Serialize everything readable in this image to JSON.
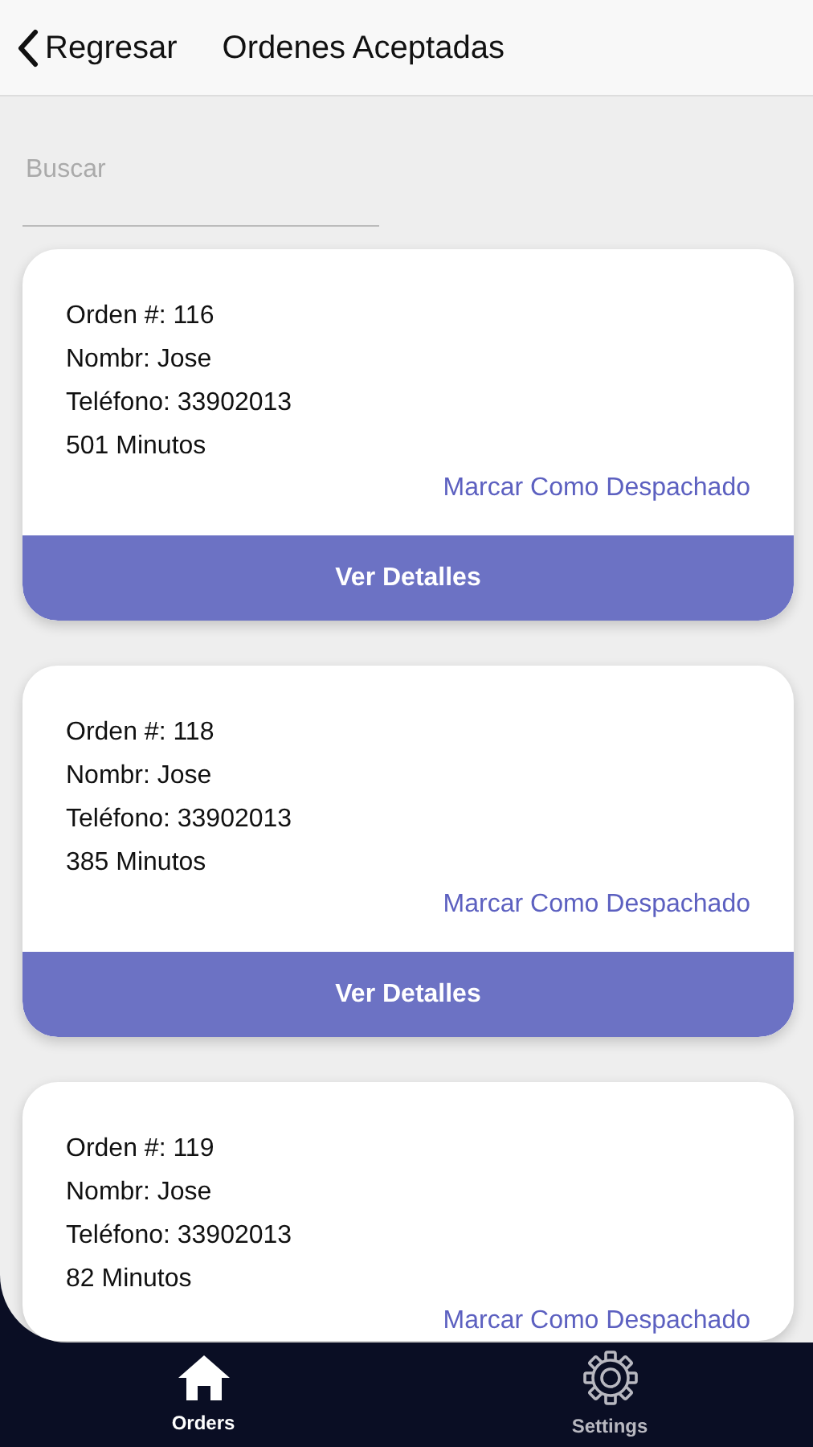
{
  "header": {
    "back": "Regresar",
    "title": "Ordenes Aceptadas"
  },
  "search": {
    "placeholder": "Buscar"
  },
  "orders": [
    {
      "order": "Orden #: 116",
      "name": "Nombr: Jose",
      "phone": "Teléfono: 33902013",
      "minutes": "501 Minutos",
      "action": "Marcar Como Despachado",
      "button": "Ver Detalles"
    },
    {
      "order": "Orden #: 118",
      "name": "Nombr: Jose",
      "phone": "Teléfono: 33902013",
      "minutes": "385 Minutos",
      "action": "Marcar Como Despachado",
      "button": "Ver Detalles"
    },
    {
      "order": "Orden #: 119",
      "name": "Nombr: Jose",
      "phone": "Teléfono: 33902013",
      "minutes": "82 Minutos",
      "action": "Marcar Como Despachado"
    }
  ],
  "tab_bar": [
    {
      "kind": "home",
      "label": "Orders",
      "selected": true
    },
    {
      "kind": "settings",
      "label": "Settings",
      "selected": false
    }
  ]
}
